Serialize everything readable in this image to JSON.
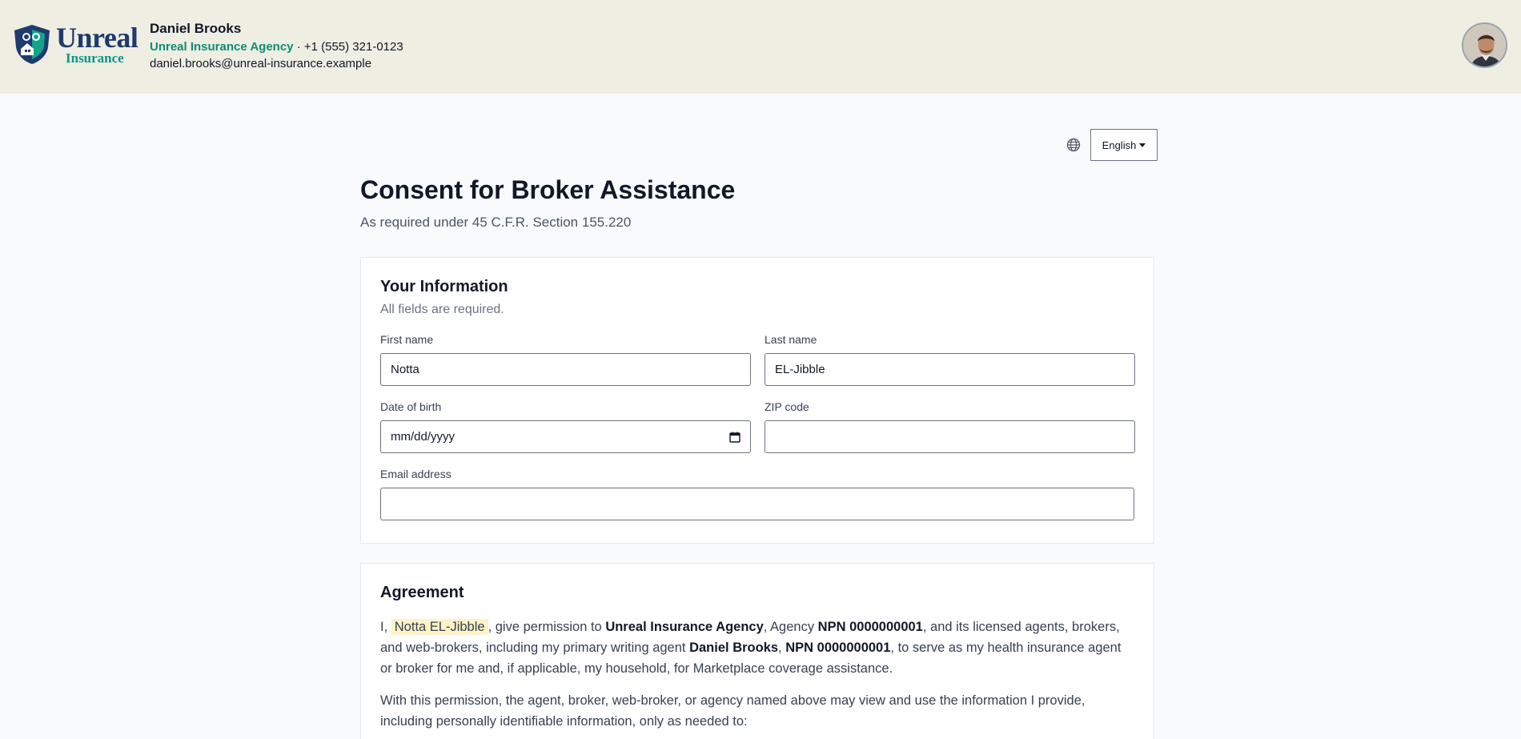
{
  "header": {
    "logo_word": "Unreal",
    "logo_sub": "Insurance",
    "agent_name": "Daniel Brooks",
    "agency_name": "Unreal Insurance Agency",
    "phone_sep": " · +1 (555) 321-0123",
    "email": "daniel.brooks@unreal-insurance.example"
  },
  "language": {
    "selected": "English"
  },
  "page": {
    "title": "Consent for Broker Assistance",
    "subtitle": "As required under 45 C.F.R. Section 155.220"
  },
  "info": {
    "heading": "Your Information",
    "hint": "All fields are required.",
    "first_name_label": "First name",
    "first_name_value": "Notta",
    "last_name_label": "Last name",
    "last_name_value": "EL-Jibble",
    "dob_label": "Date of birth",
    "dob_placeholder": "mm/dd/yyyy",
    "zip_label": "ZIP code",
    "zip_value": "",
    "email_label": "Email address",
    "email_value": ""
  },
  "agreement": {
    "heading": "Agreement",
    "p1_a": "I, ",
    "p1_name": "Notta EL-Jibble",
    "p1_b": ", give permission to ",
    "p1_agency": "Unreal Insurance Agency",
    "p1_c": ", Agency ",
    "p1_npn1": "NPN 0000000001",
    "p1_d": ", and its licensed agents, brokers, and web-brokers, including my primary writing agent ",
    "p1_agent": "Daniel Brooks",
    "p1_e": ", ",
    "p1_npn2": "NPN 0000000001",
    "p1_f": ", to serve as my health insurance agent or broker for me and, if applicable, my household, for Marketplace coverage assistance.",
    "p2": "With this permission, the agent, broker, web-broker, or agency named above may view and use the information I provide, including personally identifiable information, only as needed to:"
  },
  "colors": {
    "header_bg": "#eeeee3",
    "brand_navy": "#1e3a6e",
    "brand_teal": "#0f8c73",
    "highlight": "#fef3c7"
  }
}
